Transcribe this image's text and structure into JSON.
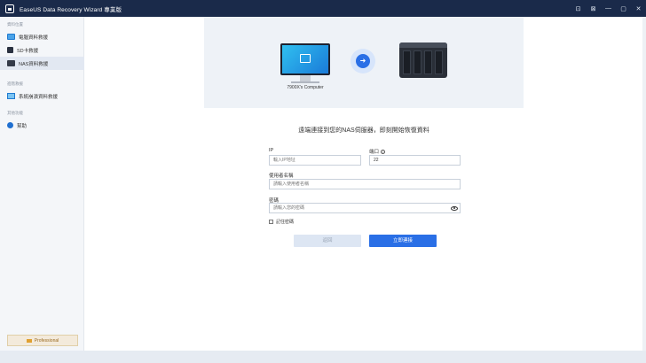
{
  "window": {
    "title": "EaseUS Data Recovery Wizard 專業版",
    "controls": [
      "⊡",
      "⊠",
      "—",
      "▢",
      "✕"
    ]
  },
  "sidebar": {
    "sections": [
      {
        "label": "資料位置",
        "items": [
          {
            "label": "電腦資料救援",
            "icon": "monitor-icon"
          },
          {
            "label": "SD卡救援",
            "icon": "sd-card-icon"
          },
          {
            "label": "NAS資料救援",
            "icon": "nas-icon",
            "active": true
          }
        ]
      },
      {
        "label": "進階救援",
        "items": [
          {
            "label": "系統崩潰資料救援",
            "icon": "system-crash-icon"
          }
        ]
      },
      {
        "label": "其他功能",
        "items": [
          {
            "label": "幫助",
            "icon": "help-icon"
          }
        ]
      }
    ],
    "promo_label": "Professional"
  },
  "banner": {
    "computer_label": "7900X's Computer"
  },
  "form": {
    "heading": "遠端連接到您的NAS伺服器，即刻開始恢復資料",
    "ip_label": "IP",
    "ip_placeholder": "輸入IP地址",
    "port_label": "端口",
    "port_value": "22",
    "username_label": "使用者名稱",
    "username_placeholder": "請輸入使用者名稱",
    "password_label": "密碼",
    "password_placeholder": "請輸入您的密碼",
    "remember_label": "記住密碼",
    "back_button": "返回",
    "connect_button": "立即連接"
  },
  "colors": {
    "titlebar": "#1a2a4a",
    "accent": "#2a6fe6",
    "sidebar_active": "#e2e8f2"
  }
}
